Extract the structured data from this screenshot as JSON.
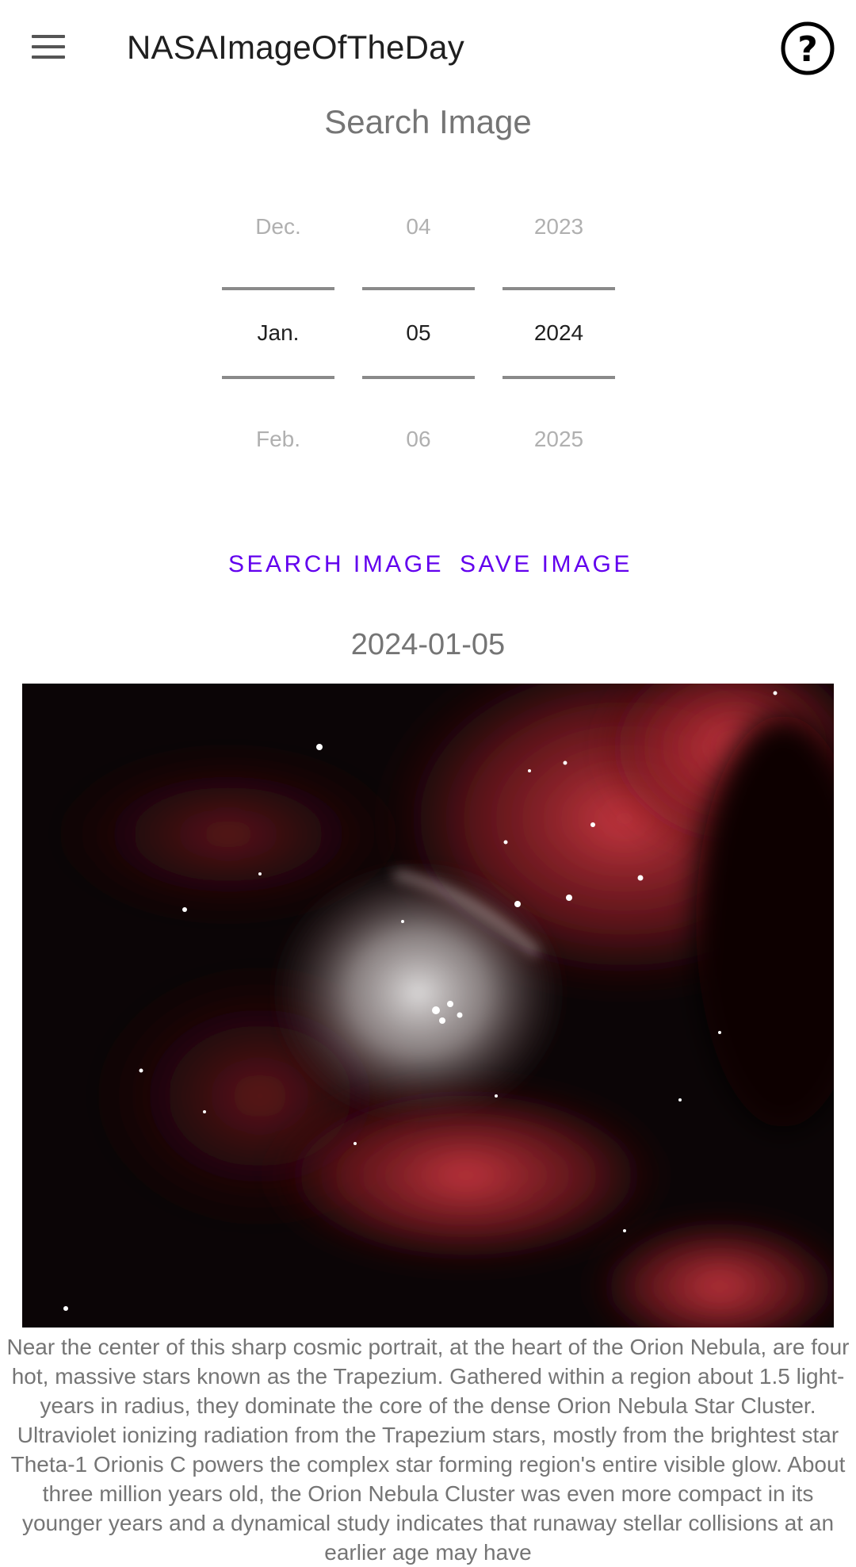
{
  "app": {
    "title": "NASAImageOfTheDay",
    "menu_icon": "hamburger-menu-icon",
    "help_icon": "help-circle-icon"
  },
  "search": {
    "heading": "Search Image",
    "month": {
      "previous": "Dec.",
      "selected": "Jan.",
      "next": "Feb."
    },
    "day": {
      "previous": "04",
      "selected": "05",
      "next": "06"
    },
    "year": {
      "previous": "2023",
      "selected": "2024",
      "next": "2025"
    },
    "search_button": "SEARCH IMAGE",
    "save_button": "SAVE IMAGE"
  },
  "result": {
    "date": "2024-01-05",
    "description": "Near the center of this sharp cosmic portrait, at the heart of the Orion Nebula, are four hot, massive stars known as the Trapezium. Gathered within a region about 1.5 light-years in radius, they dominate the core of the dense Orion Nebula Star Cluster. Ultraviolet ionizing radiation from the Trapezium stars, mostly from the brightest star Theta-1 Orionis C powers the complex star forming region's entire visible glow. About three million years old, the Orion Nebula Cluster was even more compact in its younger years and a dynamical study indicates that runaway stellar collisions at an earlier age may have"
  },
  "colors": {
    "accent": "#6200ee",
    "text_secondary": "#757575",
    "picker_faded": "#b0b0b0",
    "nebula_red": "#c8323c",
    "nebula_core": "#c9c4c4"
  }
}
